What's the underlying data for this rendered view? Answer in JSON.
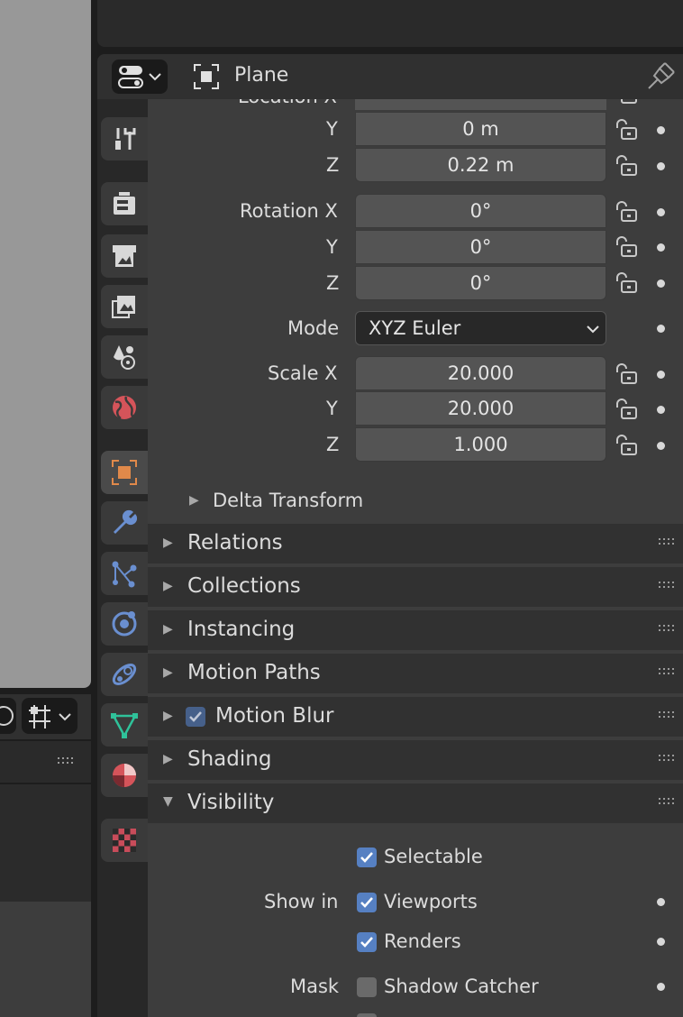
{
  "header": {
    "object_name": "Plane"
  },
  "transform": {
    "location_partial": "Location X",
    "location_y_label": "Y",
    "location_y_value": "0 m",
    "location_z_label": "Z",
    "location_z_value": "0.22 m",
    "rotation_x_label": "Rotation X",
    "rotation_x_value": "0°",
    "rotation_y_label": "Y",
    "rotation_y_value": "0°",
    "rotation_z_label": "Z",
    "rotation_z_value": "0°",
    "mode_label": "Mode",
    "mode_value": "XYZ Euler",
    "scale_x_label": "Scale X",
    "scale_x_value": "20.000",
    "scale_y_label": "Y",
    "scale_y_value": "20.000",
    "scale_z_label": "Z",
    "scale_z_value": "1.000",
    "delta_transform": "Delta Transform"
  },
  "panels": {
    "relations": "Relations",
    "collections": "Collections",
    "instancing": "Instancing",
    "motion_paths": "Motion Paths",
    "motion_blur": "Motion Blur",
    "shading": "Shading",
    "visibility": "Visibility"
  },
  "visibility": {
    "selectable": "Selectable",
    "show_in_label": "Show in",
    "viewports": "Viewports",
    "renders": "Renders",
    "mask_label": "Mask",
    "shadow_catcher": "Shadow Catcher"
  },
  "colors": {
    "accent_blue": "#5680c2",
    "object_orange": "#e0894a",
    "world_red": "#d5545a",
    "modifier_blue": "#6a8fd0",
    "mesh_green": "#2fc29a",
    "texture_red": "#c84c5a"
  }
}
